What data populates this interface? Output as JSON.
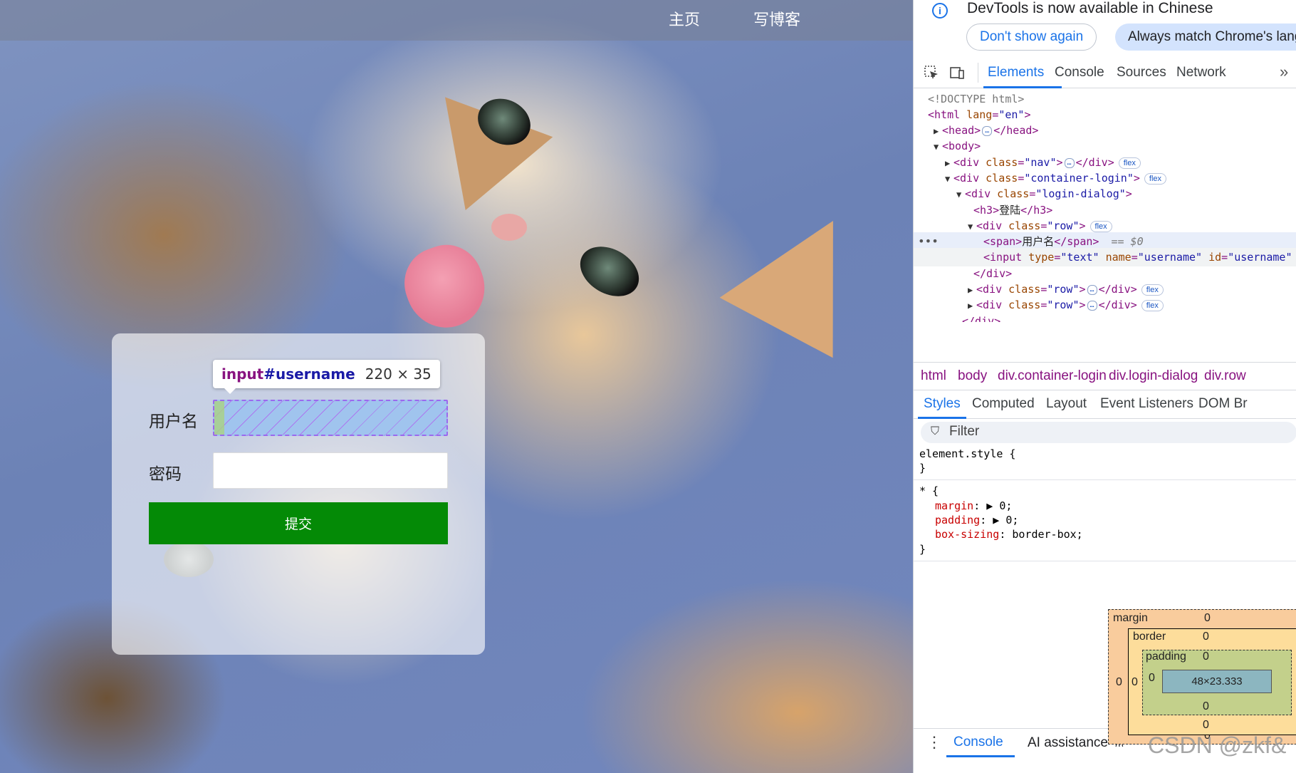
{
  "page": {
    "nav": {
      "links": [
        "主页",
        "写博客"
      ]
    },
    "login": {
      "username_label": "用户名",
      "password_label": "密码",
      "submit_label": "提交"
    },
    "inspect_tooltip": {
      "tag": "input",
      "id": "#username",
      "size": "220 × 35"
    }
  },
  "devtools": {
    "infobar": {
      "text": "DevTools is now available in Chinese",
      "dont_show": "Don't show again",
      "always_match": "Always match Chrome's lang"
    },
    "tabs": [
      "Elements",
      "Console",
      "Sources",
      "Network"
    ],
    "dom": {
      "doctype": "<!DOCTYPE html>",
      "html_tag": "<html",
      "html_attr": "lang",
      "html_val": "\"en\"",
      "head_open": "<head>",
      "head_close": "</head>",
      "body_open": "<body>",
      "nav_div_class": "\"nav\"",
      "container_class": "\"container-login\"",
      "dialog_class": "\"login-dialog\"",
      "h3_text": "登陆",
      "row_class": "\"row\"",
      "span_text": "用户名",
      "selected_marker": "== $0",
      "input_type": "\"text\"",
      "input_name": "\"username\"",
      "input_id": "\"username\"",
      "flex_badge": "flex",
      "ellipsis": "…"
    },
    "breadcrumb": [
      "html",
      "body",
      "div.container-login",
      "div.login-dialog",
      "div.row"
    ],
    "style_tabs": [
      "Styles",
      "Computed",
      "Layout",
      "Event Listeners",
      "DOM Br"
    ],
    "filter_placeholder": "Filter",
    "rules": {
      "element_style": "element.style {",
      "close": "}",
      "star": "* {",
      "margin_prop": "margin",
      "margin_val": "0;",
      "padding_prop": "padding",
      "padding_val": "0;",
      "box_prop": "box-sizing",
      "box_val": "border-box;"
    },
    "box_model": {
      "margin_label": "margin",
      "border_label": "border",
      "padding_label": "padding",
      "zero": "0",
      "content_size": "48×23.333"
    },
    "drawer": {
      "console": "Console",
      "ai": "AI assistance ⚗"
    },
    "watermark": "CSDN @zkf&"
  },
  "colors": {
    "accent": "#1a73e8",
    "submit_green": "#048a06",
    "selected_row": "#e8eefa"
  }
}
